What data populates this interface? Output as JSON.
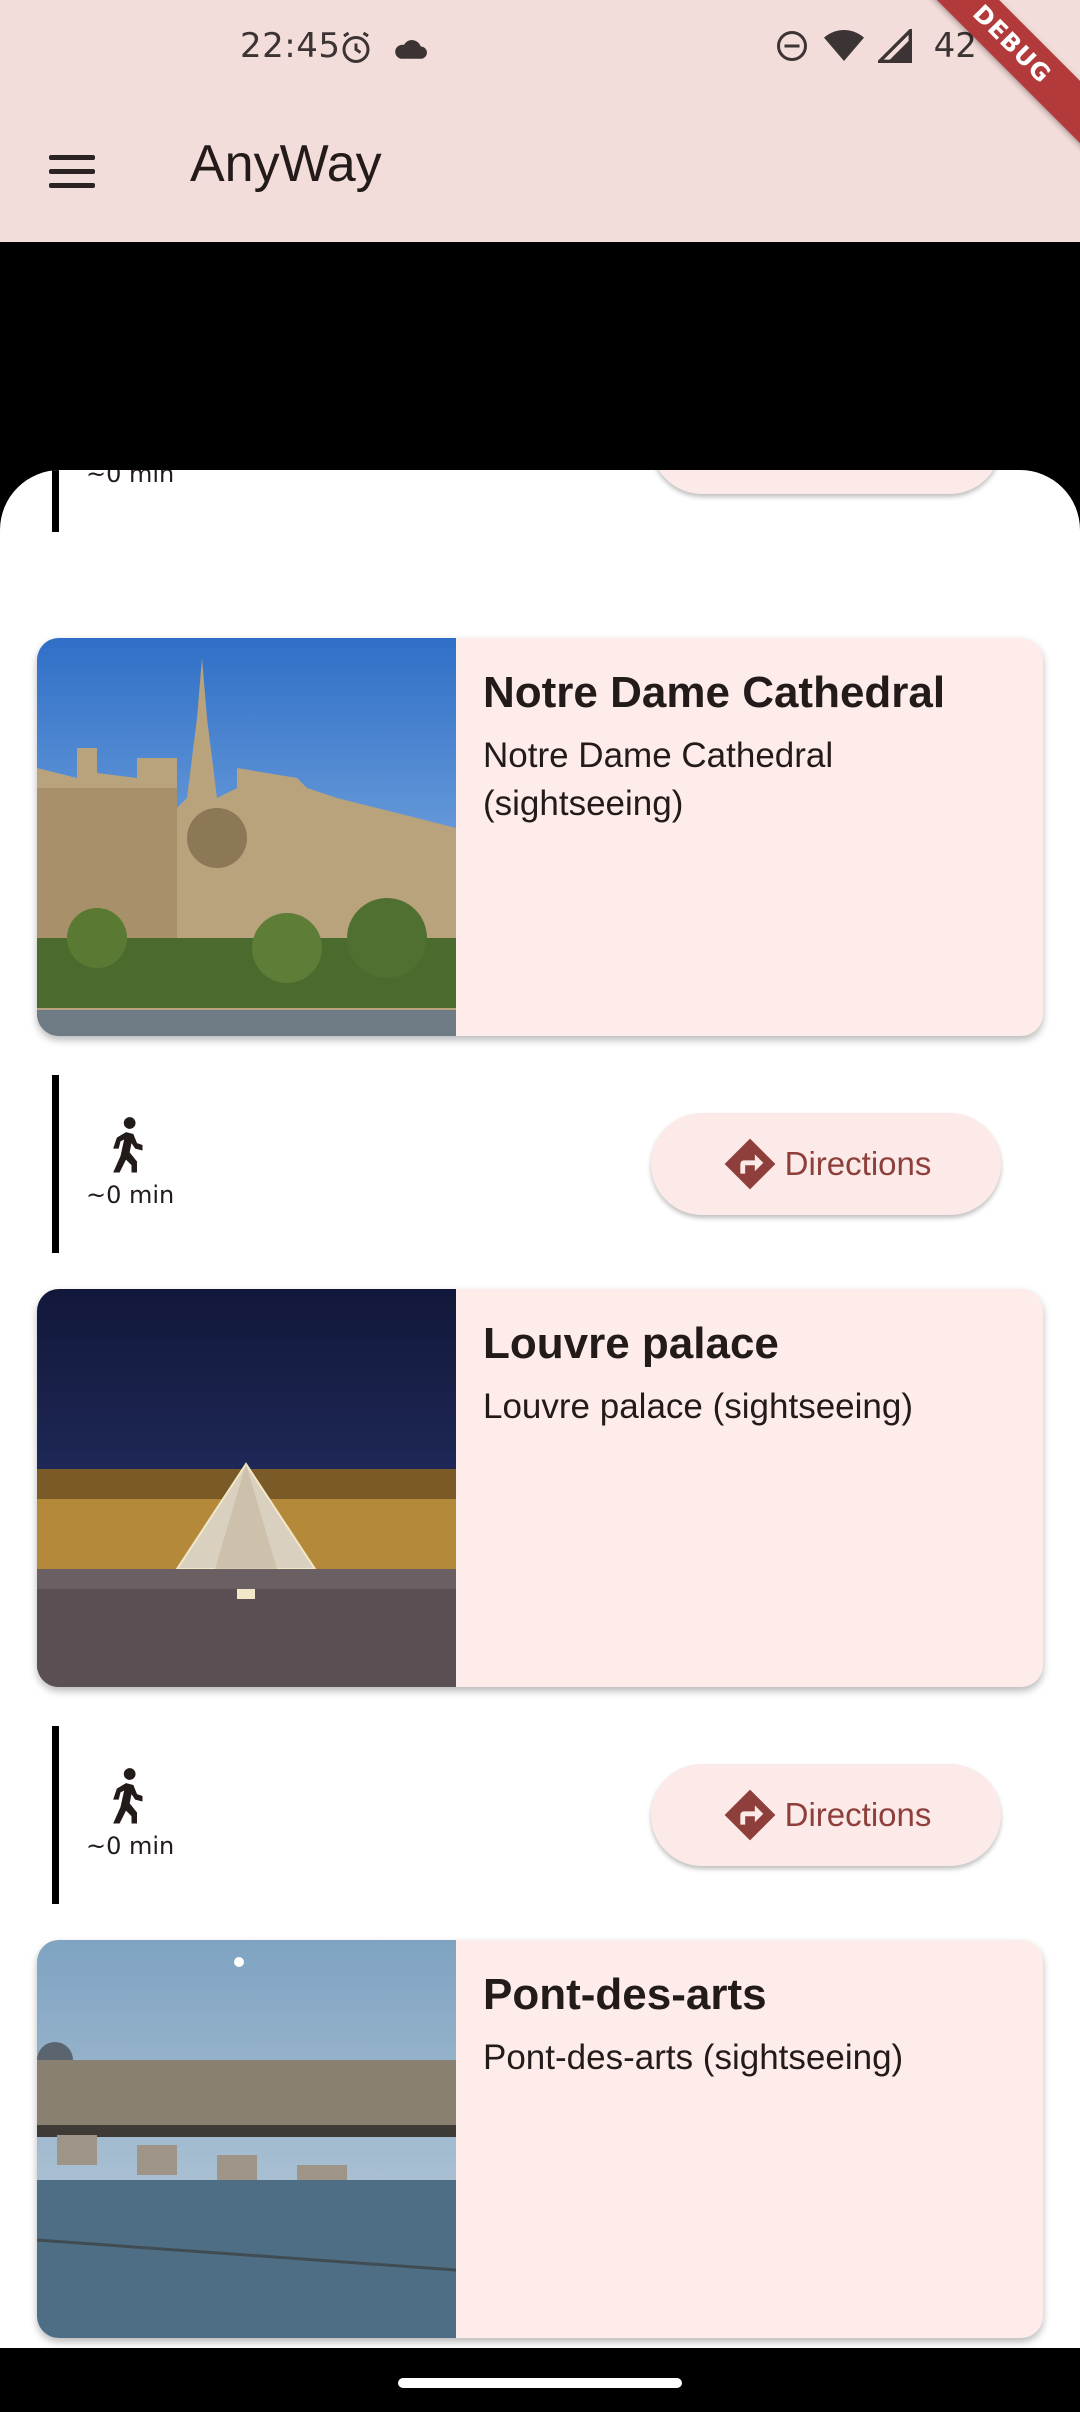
{
  "status_bar": {
    "time": "22:45",
    "battery": "42 %",
    "icons": [
      "alarm-icon",
      "cloud-icon",
      "dnd-icon",
      "wifi-icon",
      "signal-icon"
    ]
  },
  "debug_banner": "DEBUG",
  "app_bar": {
    "title": "AnyWay",
    "menu_icon": "menu-icon"
  },
  "itinerary": {
    "top_leg": {
      "time": "~0 min"
    },
    "stops": [
      {
        "title": "Notre Dame Cathedral",
        "subtitle": "Notre Dame Cathedral (sightseeing)",
        "leg_after": {
          "time": "~0 min",
          "button": "Directions"
        }
      },
      {
        "title": "Louvre palace",
        "subtitle": "Louvre palace (sightseeing)",
        "leg_after": {
          "time": "~0 min",
          "button": "Directions"
        }
      },
      {
        "title": "Pont-des-arts",
        "subtitle": "Pont-des-arts (sightseeing)"
      }
    ]
  },
  "colors": {
    "app_bar": "#f3ddda",
    "card": "#fdecea",
    "accent": "#8e3f3b"
  }
}
